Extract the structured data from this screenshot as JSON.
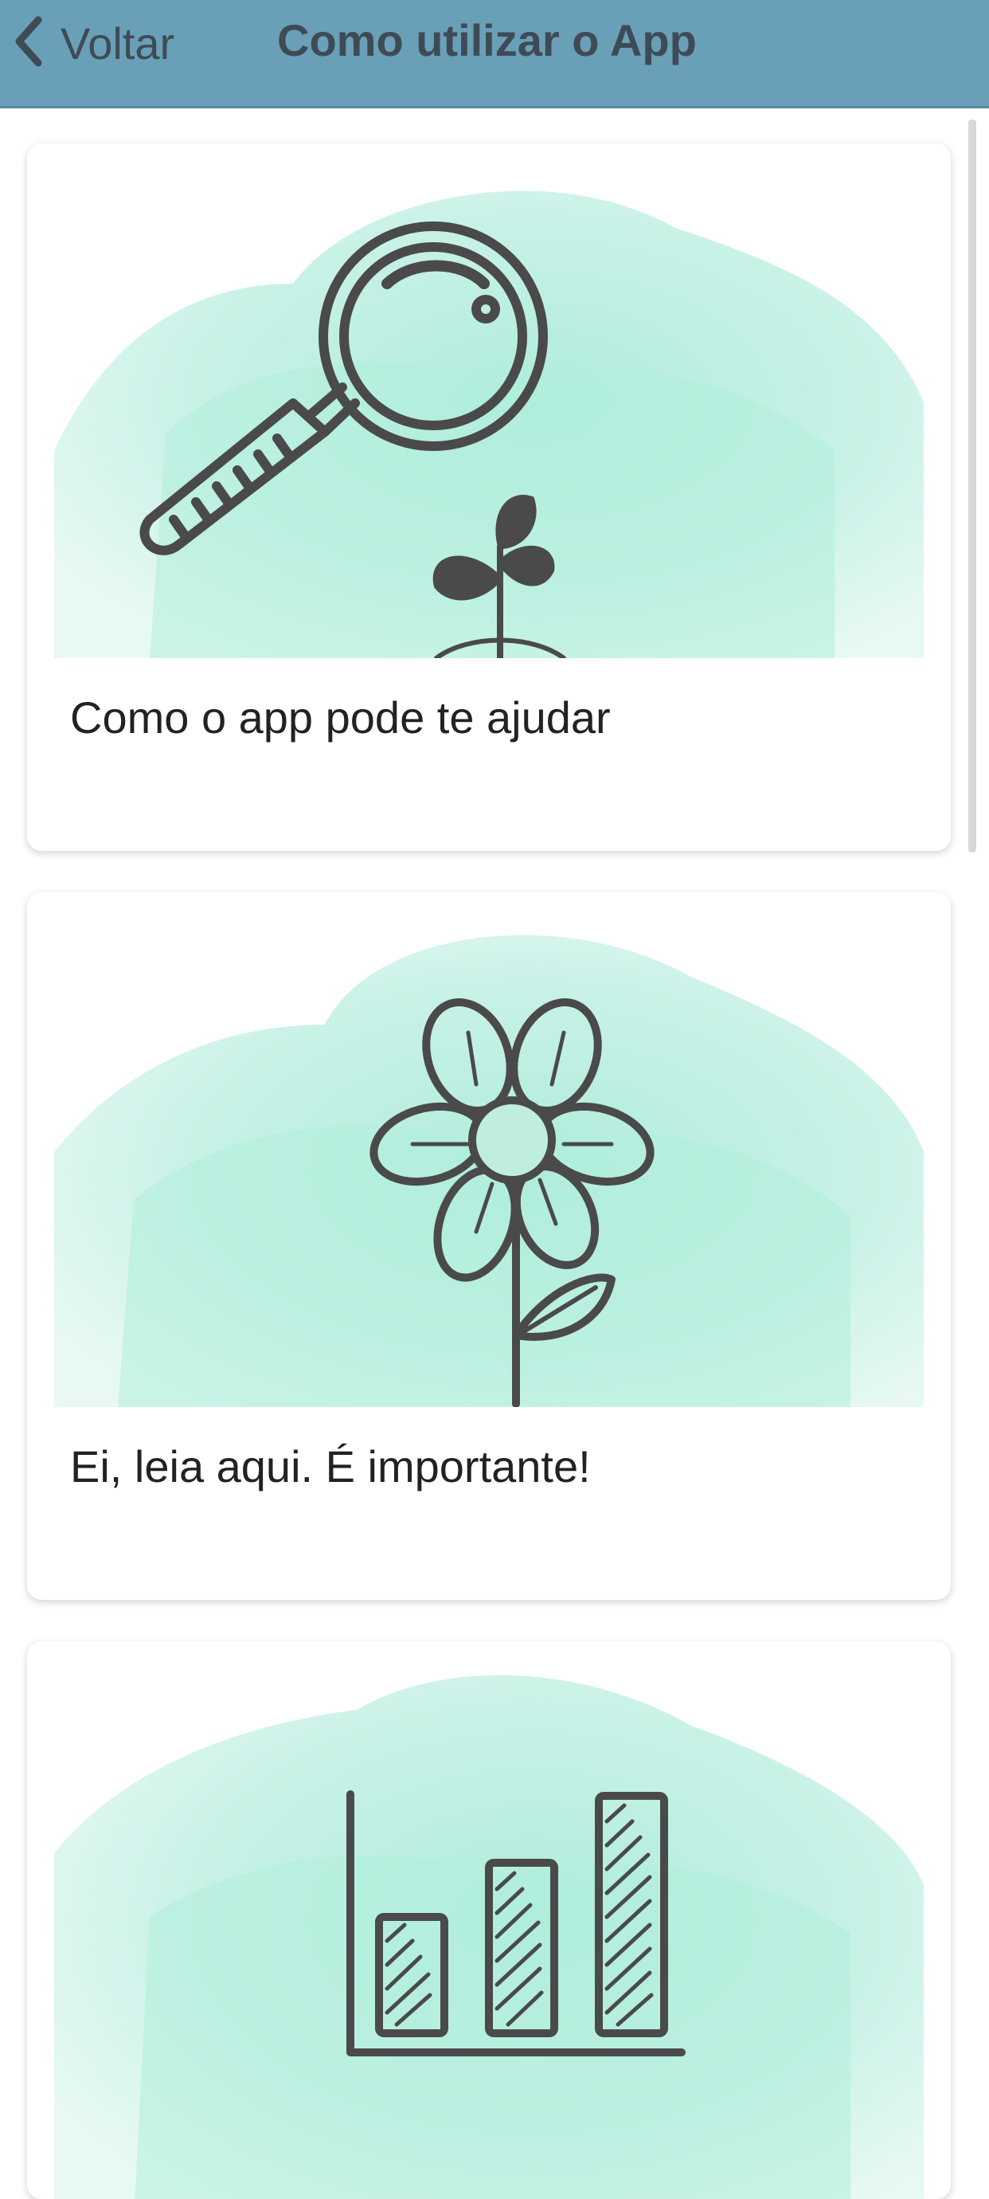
{
  "header": {
    "back_label": "Voltar",
    "title": "Como utilizar o App",
    "background": "#6a9fb8"
  },
  "cards": [
    {
      "label": "Como o app pode te ajudar",
      "icon": "magnifier-plant-icon"
    },
    {
      "label": "Ei, leia aqui. É importante!",
      "icon": "flower-icon"
    },
    {
      "label": "",
      "icon": "bar-chart-icon"
    }
  ],
  "colors": {
    "watercolor": "#b8ede0",
    "ink": "#4a4a4a"
  }
}
